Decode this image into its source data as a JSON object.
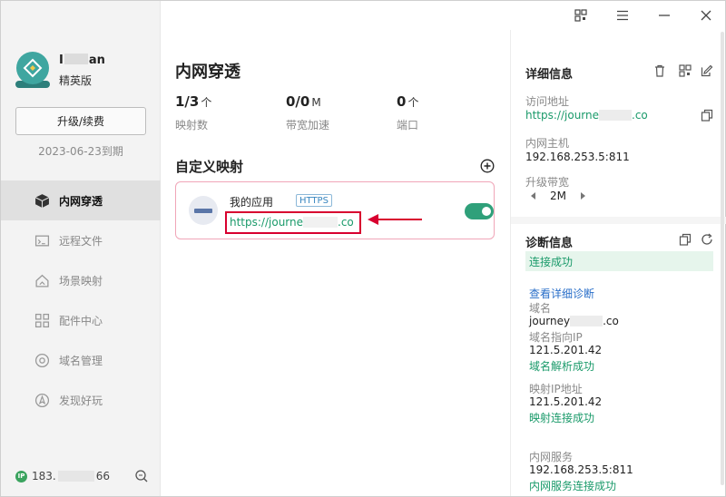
{
  "user": {
    "name_prefix": "I",
    "name_suffix": "an",
    "plan": "精英版",
    "upgrade_label": "升级/续费",
    "expiry": "2023-06-23到期"
  },
  "sidebar": {
    "items": [
      {
        "label": "内网穿透",
        "icon": "cube-icon",
        "active": true
      },
      {
        "label": "远程文件",
        "icon": "folder-icon",
        "active": false
      },
      {
        "label": "场景映射",
        "icon": "house-icon",
        "active": false
      },
      {
        "label": "配件中心",
        "icon": "grid-icon",
        "active": false
      },
      {
        "label": "域名管理",
        "icon": "globe-gear-icon",
        "active": false
      },
      {
        "label": "发现好玩",
        "icon": "compass-icon",
        "active": false
      }
    ],
    "ip_badge": "IP",
    "ip_prefix": "183.",
    "ip_suffix": "66"
  },
  "main": {
    "title": "内网穿透",
    "stats": [
      {
        "value": "1/3",
        "unit": "个",
        "label": "映射数"
      },
      {
        "value": "0/0",
        "unit": "M",
        "label": "带宽加速"
      },
      {
        "value": "0",
        "unit": "个",
        "label": "端口"
      }
    ],
    "section_title": "自定义映射",
    "mapping": {
      "name": "我的应用",
      "protocol": "HTTPS",
      "url_prefix": "https://journe",
      "url_suffix": ".co",
      "enabled": true
    }
  },
  "details": {
    "title": "详细信息",
    "access_label": "访问地址",
    "access_prefix": "https://journe",
    "access_suffix": ".co",
    "host_label": "内网主机",
    "host_value": "192.168.253.5:811",
    "bandwidth_label": "升级带宽",
    "bandwidth_value": "2M"
  },
  "diagnosis": {
    "title": "诊断信息",
    "status": "连接成功",
    "detail_link": "查看详细诊断",
    "domain_label": "域名",
    "domain_prefix": "journey",
    "domain_suffix": ".co",
    "dns_label": "域名指向IP",
    "dns_value": "121.5.201.42",
    "dns_status": "域名解析成功",
    "map_ip_label": "映射IP地址",
    "map_ip_value": "121.5.201.42",
    "map_status": "映射连接成功",
    "service_label": "内网服务",
    "service_value": "192.168.253.5:811",
    "service_status": "内网服务连接成功"
  },
  "colors": {
    "accent": "#1a9a6a",
    "highlight": "#d8002f",
    "link": "#2a6fc9"
  }
}
